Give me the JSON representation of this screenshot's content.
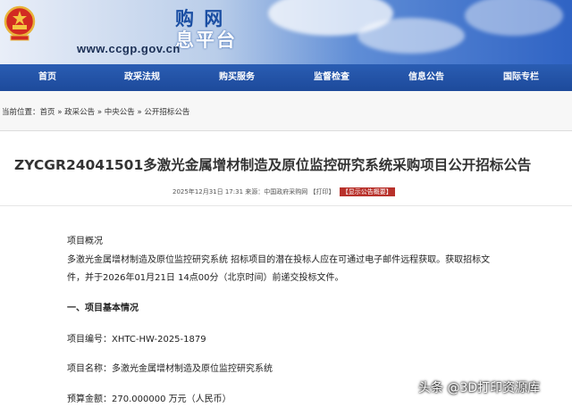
{
  "header": {
    "title_line1": "购 网",
    "title_line2": "息平台",
    "url": "www.ccgp.gov.cn",
    "colors": {
      "accent": "#1b4fa3",
      "nav_bg": "#2a5db3",
      "badge": "#b8312b"
    }
  },
  "nav": {
    "items": [
      {
        "label": "首页"
      },
      {
        "label": "政采法规"
      },
      {
        "label": "购买服务"
      },
      {
        "label": "监督检查"
      },
      {
        "label": "信息公告"
      },
      {
        "label": "国际专栏"
      }
    ]
  },
  "breadcrumb": {
    "prefix": "当前位置：",
    "items": [
      "首页",
      "政采公告",
      "中央公告",
      "公开招标公告"
    ],
    "separator": " » "
  },
  "article": {
    "title": "ZYCGR24041501多激光金属增材制造及原位监控研究系统采购项目公开招标公告",
    "meta_text": "2025年12月31日 17:31 来源：中国政府采购网",
    "print_label": "【打印】",
    "summary_label": "【显示公告概要】",
    "overview_heading": "项目概况",
    "overview_line1": "多激光金属增材制造及原位监控研究系统 招标项目的潜在投标人应在可通过电子邮件远程获取。获取招标文",
    "overview_line2": "件，并于2026年01月21日 14点00分（北京时间）前递交投标文件。",
    "section1_heading": "一、项目基本情况",
    "project_no": "项目编号：XHTC-HW-2025-1879",
    "project_name": "项目名称：多激光金属增材制造及原位监控研究系统",
    "budget": "预算金额：270.000000 万元（人民币）"
  },
  "watermark": "头条 @3D打印资源库"
}
